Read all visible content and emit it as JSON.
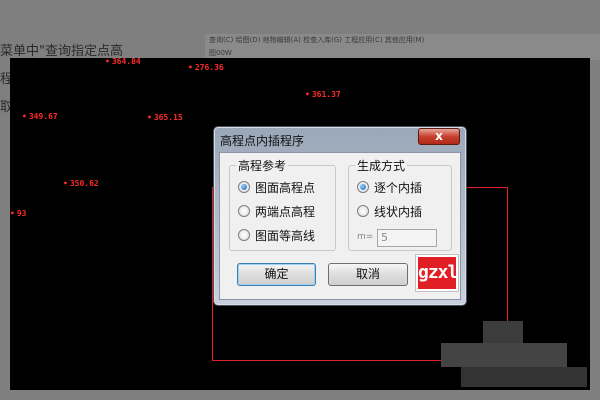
{
  "background": {
    "line1": "菜单中\"查询指定点高",
    "line2": "程",
    "line3": "取",
    "toolbar_row1": "查询(C)  绘图(D)  地物编辑(A)  检查入库(G)  工程应用(C)  其他应用(M)",
    "toolbar_row2": "图00W"
  },
  "cad_points": [
    {
      "label": "364.84"
    },
    {
      "label": "276.36"
    },
    {
      "label": "361.37"
    },
    {
      "label": "349.67"
    },
    {
      "label": "365.15"
    },
    {
      "label": "350.62"
    },
    {
      "label": "93"
    }
  ],
  "dialog": {
    "title": "高程点内插程序",
    "close_label": "x",
    "group_left": {
      "title": "高程参考",
      "options": [
        "图面高程点",
        "两端点高程",
        "图面等高线"
      ],
      "selected": 0
    },
    "group_right": {
      "title": "生成方式",
      "options": [
        "逐个内插",
        "线状内插"
      ],
      "selected": 0,
      "m_label": "m=",
      "m_value": "5"
    },
    "ok_label": "确定",
    "cancel_label": "取消",
    "logo_text": "gzxl"
  },
  "colors": {
    "canvas": "#000000",
    "point_text": "#ff2a2a",
    "selection_box": "#e0202a",
    "logo_bg": "#e01e24"
  }
}
